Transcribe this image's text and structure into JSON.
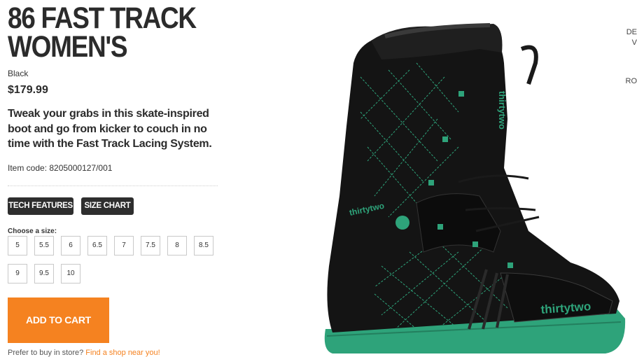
{
  "product": {
    "title_line1": "86 FAST TRACK",
    "title_line2": "WOMEN'S",
    "color": "Black",
    "price": "$179.99",
    "description": "Tweak your grabs in this skate-inspired boot and go from kicker to couch in no time with the Fast Track Lacing System.",
    "item_code": "Item code: 8205000127/001",
    "image_brand_text": "thirtytwo"
  },
  "tabs": {
    "tech_features": "TECH FEATURES",
    "size_chart": "SIZE CHART"
  },
  "sizes": {
    "label": "Choose a size:",
    "options": [
      "5",
      "5.5",
      "6",
      "6.5",
      "7",
      "7.5",
      "8",
      "8.5",
      "9",
      "9.5",
      "10"
    ]
  },
  "cart": {
    "add_label": "ADD TO CART",
    "store_prompt": "Prefer to buy in store? ",
    "store_link": "Find a shop near you!"
  },
  "side_cutoff": {
    "line1": "DE",
    "line2": "V",
    "line3": "RO"
  },
  "colors": {
    "accent_orange": "#f58220",
    "button_dark": "#2e2e2e",
    "boot_green": "#2ea37a"
  }
}
